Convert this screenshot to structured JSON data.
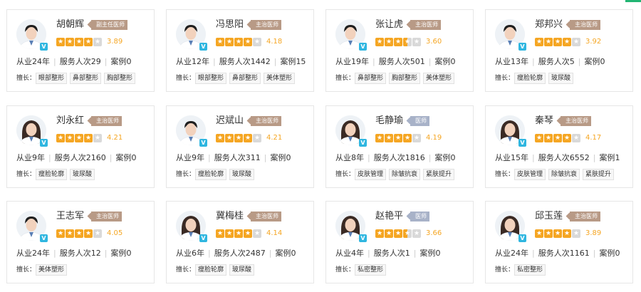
{
  "labels": {
    "years_prefix": "从业",
    "years_suffix": "年",
    "served_prefix": "服务人次",
    "cases_prefix": "案例",
    "skills_label": "擅长：",
    "verified": "V"
  },
  "colors": {
    "star": "#f5a623",
    "star_empty": "#d9d9d9",
    "badge_senior": "#b89a86",
    "badge_doctor": "#a8b2c8",
    "accent": "#22b573",
    "verified": "#2fb6e0"
  },
  "doctors": [
    {
      "name": "胡朝辉",
      "title": "副主任医师",
      "rating": 4,
      "score": "3.89",
      "years": "24",
      "served": "29",
      "cases": "0",
      "skills": [
        "眼部整形",
        "鼻部整形",
        "胸部整形"
      ],
      "gender": "m"
    },
    {
      "name": "冯思阳",
      "title": "主治医师",
      "rating": 4,
      "score": "4.18",
      "years": "12",
      "served": "1442",
      "cases": "15",
      "skills": [
        "眼部整形",
        "鼻部整形",
        "美体塑形"
      ],
      "gender": "m"
    },
    {
      "name": "张让虎",
      "title": "主治医师",
      "rating": 3.5,
      "score": "3.60",
      "years": "19",
      "served": "501",
      "cases": "0",
      "skills": [
        "鼻部整形",
        "胸部整形",
        "美体塑形"
      ],
      "gender": "m"
    },
    {
      "name": "郑邦兴",
      "title": "主治医师",
      "rating": 4,
      "score": "3.92",
      "years": "13",
      "served": "5",
      "cases": "0",
      "skills": [
        "瘦脸轮廓",
        "玻尿酸"
      ],
      "gender": "m"
    },
    {
      "name": "刘永红",
      "title": "主治医师",
      "rating": 4,
      "score": "4.21",
      "years": "9",
      "served": "2160",
      "cases": "0",
      "skills": [
        "瘦脸轮廓",
        "玻尿酸"
      ],
      "gender": "f"
    },
    {
      "name": "迟斌山",
      "title": "主治医师",
      "rating": 4,
      "score": "4.21",
      "years": "9",
      "served": "311",
      "cases": "0",
      "skills": [
        "瘦脸轮廓",
        "玻尿酸"
      ],
      "gender": "m"
    },
    {
      "name": "毛静瑜",
      "title": "医师",
      "rating": 4,
      "score": "4.19",
      "years": "8",
      "served": "1816",
      "cases": "0",
      "skills": [
        "皮肤管理",
        "除皱抗衰",
        "紧肤提升"
      ],
      "gender": "f"
    },
    {
      "name": "秦琴",
      "title": "主治医师",
      "rating": 4,
      "score": "4.17",
      "years": "15",
      "served": "6552",
      "cases": "1",
      "skills": [
        "皮肤管理",
        "除皱抗衰",
        "紧肤提升"
      ],
      "gender": "f"
    },
    {
      "name": "王志军",
      "title": "主治医师",
      "rating": 4,
      "score": "4.05",
      "years": "24",
      "served": "12",
      "cases": "0",
      "skills": [
        "美体塑形"
      ],
      "gender": "m"
    },
    {
      "name": "冀梅桂",
      "title": "主治医师",
      "rating": 4,
      "score": "4.14",
      "years": "6",
      "served": "2487",
      "cases": "0",
      "skills": [
        "瘦脸轮廓",
        "玻尿酸"
      ],
      "gender": "f"
    },
    {
      "name": "赵艳平",
      "title": "医师",
      "rating": 3.5,
      "score": "3.66",
      "years": "4",
      "served": "1",
      "cases": "0",
      "skills": [
        "私密整形"
      ],
      "gender": "f"
    },
    {
      "name": "邱玉莲",
      "title": "主治医师",
      "rating": 4,
      "score": "3.89",
      "years": "24",
      "served": "1161",
      "cases": "0",
      "skills": [
        "私密整形"
      ],
      "gender": "f"
    }
  ]
}
